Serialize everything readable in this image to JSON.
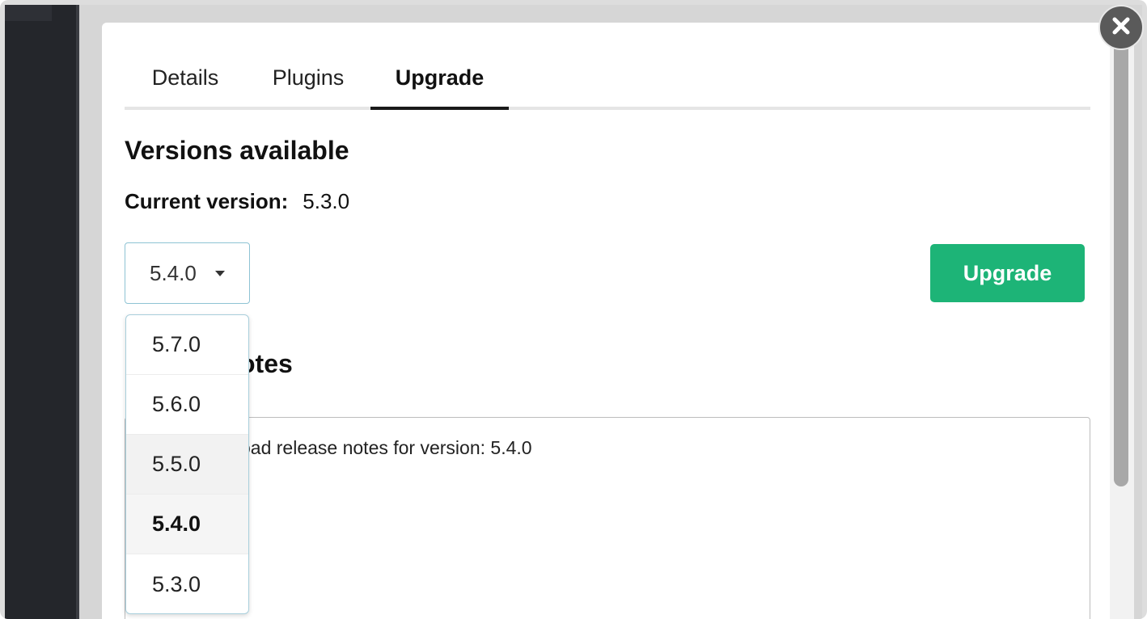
{
  "tabs": [
    {
      "label": "Details",
      "active": false
    },
    {
      "label": "Plugins",
      "active": false
    },
    {
      "label": "Upgrade",
      "active": true
    }
  ],
  "section": {
    "heading": "Versions available",
    "current_version_label": "Current version:",
    "current_version_value": "5.3.0"
  },
  "version_select": {
    "selected": "5.4.0",
    "options": [
      "5.7.0",
      "5.6.0",
      "5.5.0",
      "5.4.0",
      "5.3.0"
    ],
    "hovered": "5.5.0"
  },
  "upgrade_button": {
    "label": "Upgrade",
    "color": "#1db477"
  },
  "release_notes": {
    "heading_visible": "otes",
    "text_visible": "oad release notes for version: 5.4.0"
  },
  "icons": {
    "close": "close-icon",
    "caret": "caret-down-icon"
  }
}
